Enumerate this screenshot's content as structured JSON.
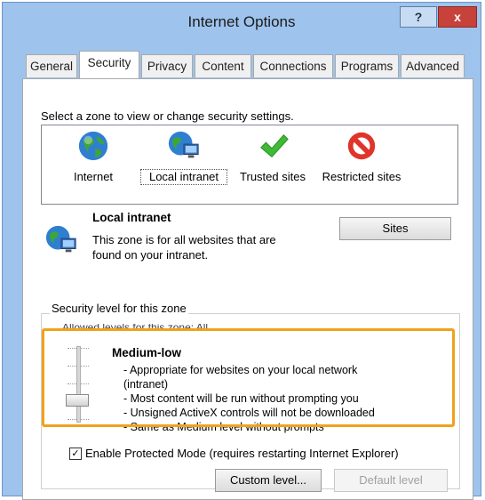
{
  "window": {
    "title": "Internet Options",
    "help_label": "?",
    "close_label": "x"
  },
  "tabs": [
    {
      "label": "General",
      "active": false
    },
    {
      "label": "Security",
      "active": true
    },
    {
      "label": "Privacy",
      "active": false
    },
    {
      "label": "Content",
      "active": false
    },
    {
      "label": "Connections",
      "active": false
    },
    {
      "label": "Programs",
      "active": false
    },
    {
      "label": "Advanced",
      "active": false
    }
  ],
  "security": {
    "zone_prompt": "Select a zone to view or change security settings.",
    "zones": [
      {
        "label": "Internet",
        "icon": "globe-icon"
      },
      {
        "label": "Local intranet",
        "icon": "local-intranet-icon",
        "selected": true
      },
      {
        "label": "Trusted sites",
        "icon": "green-checkmark-icon"
      },
      {
        "label": "Restricted sites",
        "icon": "restricted-icon"
      }
    ],
    "selected_zone": {
      "title": "Local intranet",
      "description": "This zone is for all websites that are found on your intranet."
    },
    "sites_button": "Sites",
    "level_group_label": "Security level for this zone",
    "allowed_levels": "Allowed levels for this zone: All",
    "level": {
      "name": "Medium-low",
      "lines": [
        "- Appropriate for websites on your local network",
        "(intranet)",
        "- Most content will be run without prompting you",
        "- Unsigned ActiveX controls will not be downloaded",
        "- Same as Medium level without prompts"
      ]
    },
    "protected_mode": {
      "label": "Enable Protected Mode (requires restarting Internet Explorer)",
      "checked": true
    },
    "custom_level_button": "Custom level...",
    "default_level_button": "Default level"
  },
  "colors": {
    "highlight": "#f0a21e",
    "title_bar": "#9ec3ec",
    "close_button": "#c7423b"
  }
}
